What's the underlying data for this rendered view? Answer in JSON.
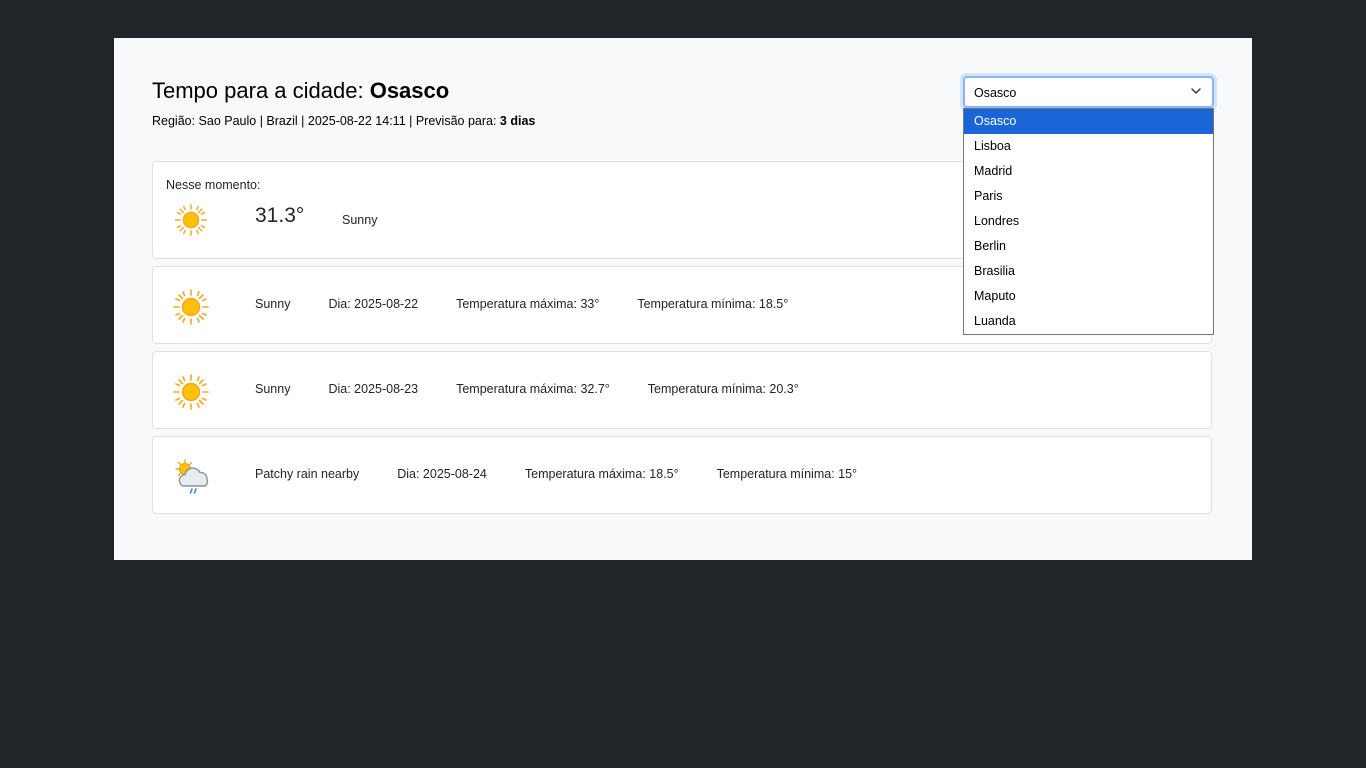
{
  "header": {
    "title_prefix": "Tempo para a cidade: ",
    "city": "Osasco",
    "meta_prefix": "Região: Sao Paulo | Brazil | 2025-08-22 14:11 | Previsão para: ",
    "forecast_days": "3 dias"
  },
  "current": {
    "label": "Nesse momento:",
    "temp": "31.3°",
    "condition": "Sunny",
    "icon": "sun-icon"
  },
  "forecast": [
    {
      "icon": "sun-icon",
      "condition": "Sunny",
      "day": "Dia: 2025-08-22",
      "max": "Temperatura máxima: 33°",
      "min": "Temperatura mínima: 18.5°"
    },
    {
      "icon": "sun-icon",
      "condition": "Sunny",
      "day": "Dia: 2025-08-23",
      "max": "Temperatura máxima: 32.7°",
      "min": "Temperatura mínima: 20.3°"
    },
    {
      "icon": "patchy-rain-icon",
      "condition": "Patchy rain nearby",
      "day": "Dia: 2025-08-24",
      "max": "Temperatura máxima: 18.5°",
      "min": "Temperatura mínima: 15°"
    }
  ],
  "city_select": {
    "value": "Osasco",
    "options": [
      "Osasco",
      "Lisboa",
      "Madrid",
      "Paris",
      "Londres",
      "Berlin",
      "Brasilia",
      "Maputo",
      "Luanda"
    ]
  },
  "colors": {
    "page_bg": "#212529",
    "panel_bg": "#f8f9fa",
    "selected_option": "#1a66d6",
    "focus_border": "#86b7fe",
    "sun": "#ffc107"
  }
}
